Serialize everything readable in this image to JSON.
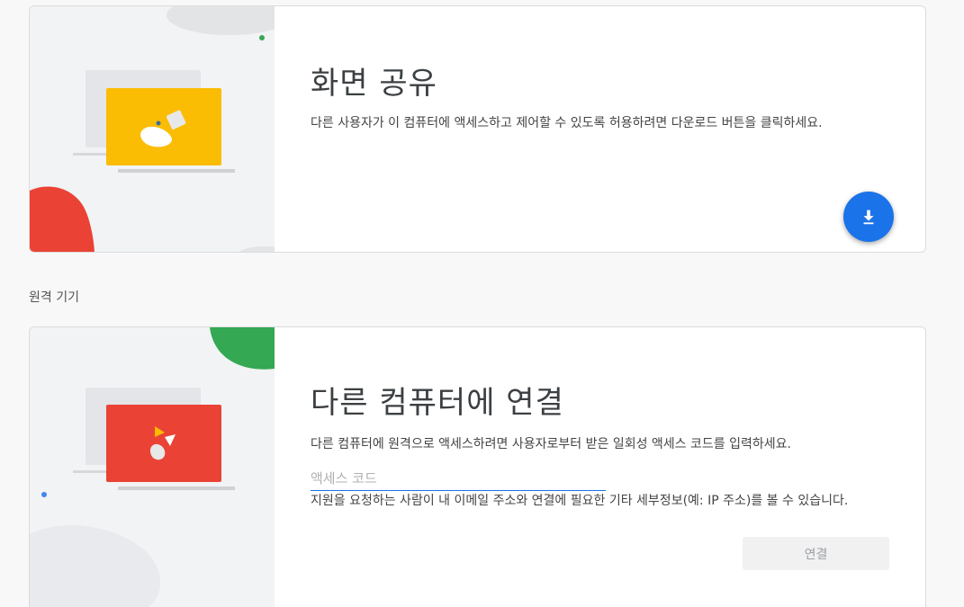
{
  "share": {
    "title": "화면 공유",
    "description": "다른 사용자가 이 컴퓨터에 액세스하고 제어할 수 있도록 허용하려면 다운로드 버튼을 클릭하세요.",
    "download_icon": "download-icon",
    "accent_color": "#1a73e8",
    "art_laptop_color": "#fbbc04"
  },
  "remote_devices": {
    "label": "원격 기기"
  },
  "connect": {
    "title": "다른 컴퓨터에 연결",
    "description": "다른 컴퓨터에 원격으로 액세스하려면 사용자로부터 받은 일회성 액세스 코드를 입력하세요.",
    "input_placeholder": "액세스 코드",
    "input_value": "",
    "helper_text": "지원을 요청하는 사람이 내 이메일 주소와 연결에 필요한 기타 세부정보(예: IP 주소)를 볼 수 있습니다.",
    "button_label": "연결",
    "art_laptop_color": "#ea4335"
  }
}
